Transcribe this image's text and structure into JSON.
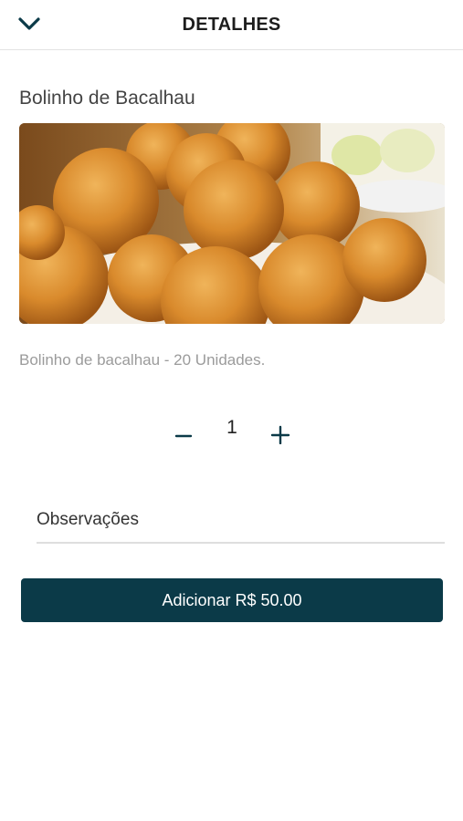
{
  "header": {
    "title": "DETALHES",
    "back_icon": "chevron-down-icon"
  },
  "product": {
    "name": "Bolinho de Bacalhau",
    "description": "Bolinho de bacalhau - 20 Unidades.",
    "image_subject": "fried codfish balls on a plate"
  },
  "quantity": {
    "value": "1",
    "decrement_icon": "minus-icon",
    "increment_icon": "plus-icon"
  },
  "notes": {
    "placeholder": "Observações",
    "value": ""
  },
  "action": {
    "add_label": "Adicionar R$ 50.00"
  },
  "colors": {
    "primary": "#0b3a48",
    "text_muted": "#9b9b9b",
    "divider": "#e3e3e3"
  }
}
